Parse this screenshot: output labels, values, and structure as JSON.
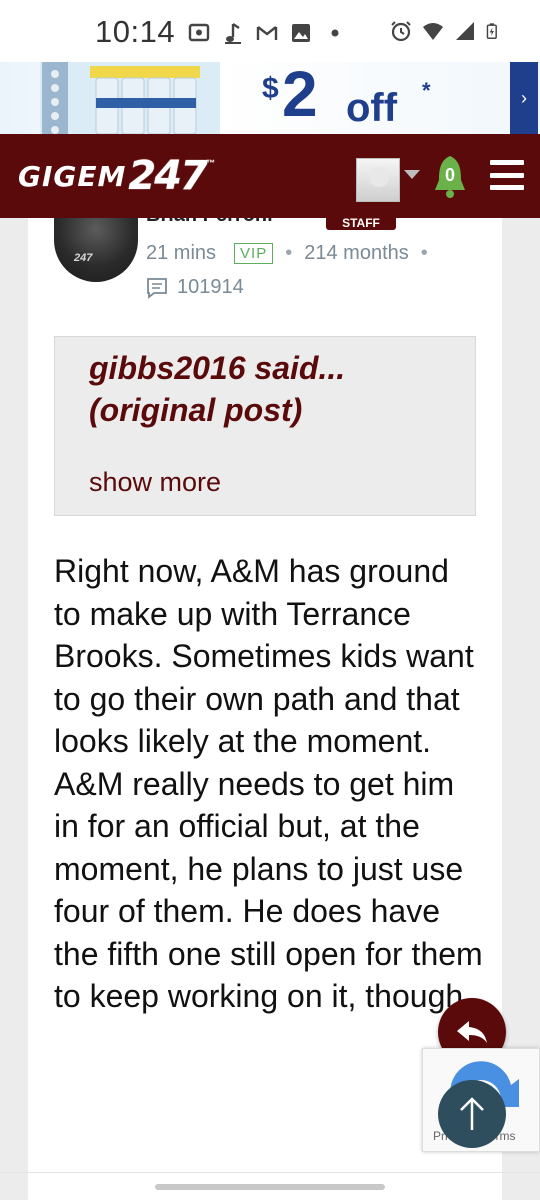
{
  "status_bar": {
    "time": "10:14",
    "icons": [
      "cast-icon",
      "music-note-icon",
      "gmail-icon",
      "image-icon",
      "dot-icon"
    ],
    "right_icons": [
      "alarm-icon",
      "wifi-icon",
      "signal-icon",
      "battery-charging-icon"
    ]
  },
  "ad": {
    "dollar": "$",
    "amount": "2",
    "off": "off",
    "asterisk": "*",
    "arrow": "›"
  },
  "header": {
    "logo_word": "GIGEM",
    "logo_number": "247",
    "logo_tm": "™",
    "notification_count": "0"
  },
  "post": {
    "author_name": "Brian Perroni",
    "staff_label": "STAFF",
    "time_ago": "21 mins",
    "vip_label": "VIP",
    "member_duration": "214 months",
    "post_count": "101914",
    "avatar_text": "247"
  },
  "quote": {
    "title": "gibbs2016 said... (original post)",
    "show_more": "show more"
  },
  "body": {
    "text": "Right now, A&M has ground to make up with Terrance Brooks. Sometimes kids want to go their own path and that looks likely at the moment. A&M really needs to get him in for an official but, at the moment, he plans to just use four of them. He does have the fifth one still open for them to keep working on it, though."
  },
  "recaptcha": {
    "text": "Privacy - Terms"
  },
  "colors": {
    "brand_maroon": "#5a0a0a",
    "vip_green": "#5cae5c",
    "scroll_top": "#2e4e5e",
    "ad_blue": "#1f3e8c"
  }
}
